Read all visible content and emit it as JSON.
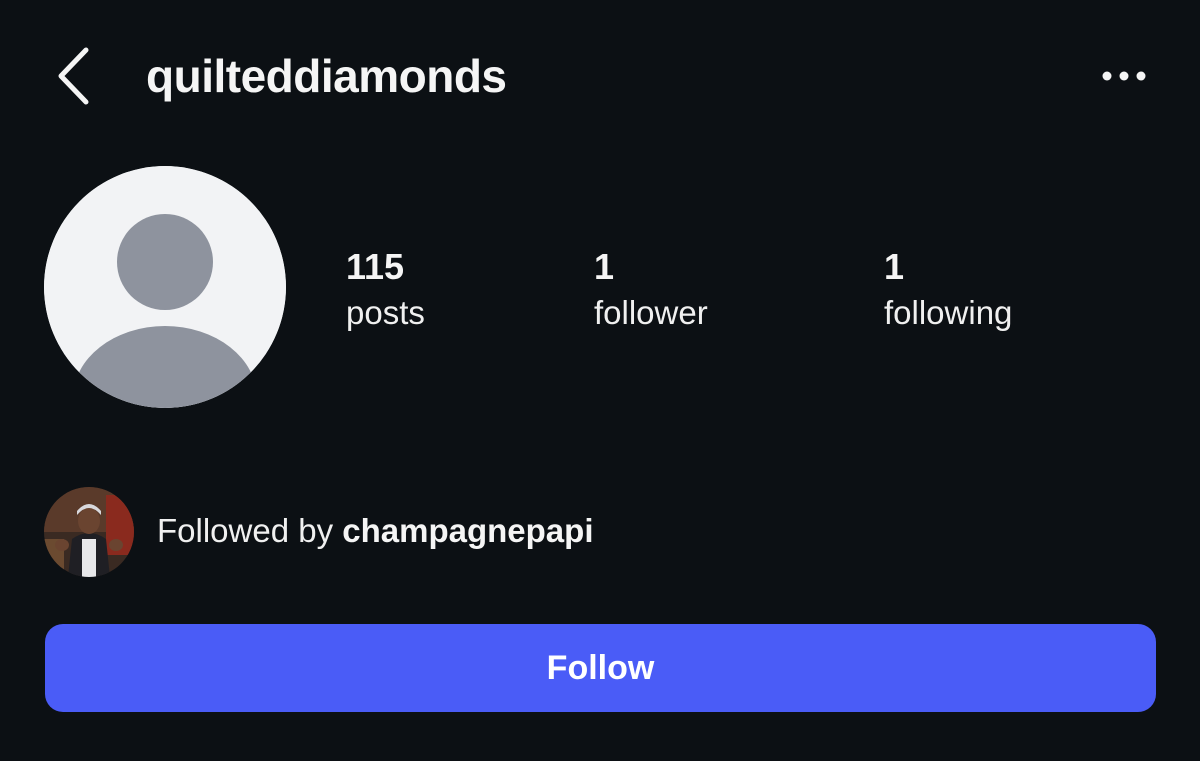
{
  "header": {
    "username": "quilteddiamonds",
    "back_icon": "chevron-left-icon",
    "more_icon": "more-horizontal-icon"
  },
  "profile": {
    "avatar_icon": "default-avatar-icon",
    "stats": [
      {
        "value": "115",
        "label": "posts"
      },
      {
        "value": "1",
        "label": "follower"
      },
      {
        "value": "1",
        "label": "following"
      }
    ]
  },
  "mutual": {
    "prefix": "Followed by ",
    "name": "champagnepapi"
  },
  "actions": {
    "follow_label": "Follow"
  },
  "colors": {
    "background": "#0c1014",
    "follow_button": "#4a5cf7",
    "avatar_bg": "#f2f3f5",
    "avatar_figure": "#8e939e",
    "text": "#f5f5f5"
  }
}
